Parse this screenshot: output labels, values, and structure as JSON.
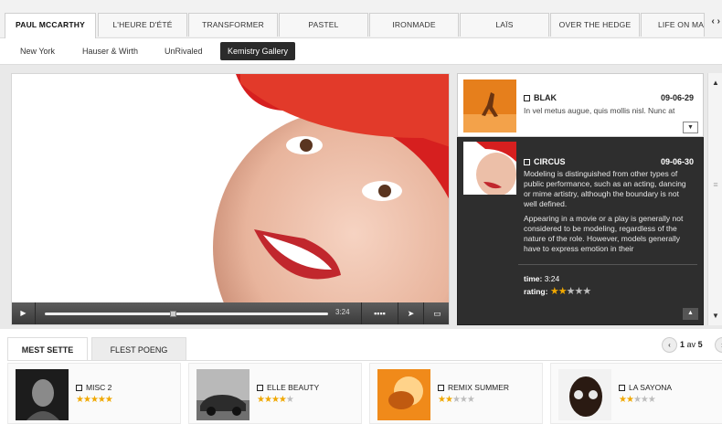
{
  "top_tabs": [
    "PAUL MCCARTHY",
    "L'HEURE D'ÉTÉ",
    "TRANSFORMER",
    "PASTEL",
    "IRONMADE",
    "LAÏS",
    "OVER THE HEDGE",
    "LIFE ON MA"
  ],
  "top_tabs_nav": "‹ ›",
  "sub_tabs": [
    "New York",
    "Hauser & Wirth",
    "UnRivaled",
    "Kemistry Gallery"
  ],
  "video": {
    "time": "3:24"
  },
  "playlist": {
    "items": [
      {
        "title": "BLAK",
        "date": "09-06-29",
        "desc": "In vel metus augue, quis mollis nisl. Nunc at"
      },
      {
        "title": "CIRCUS",
        "date": "09-06-30",
        "desc1": "Modeling is distinguished from other types of public performance, such as an acting, dancing or mime artistry, although the boundary is not well defined.",
        "desc2": "Appearing in a movie or a play is generally not considered to be modeling, regardless of the nature of the role. However, models generally have to express emotion in their",
        "time_label": "time:",
        "time": "3:24",
        "rating_label": "rating:",
        "rating": 2
      }
    ]
  },
  "bottom_tabs": [
    "MEST SETTE",
    "FLEST POENG"
  ],
  "pager": {
    "current": "1",
    "label": "av",
    "total": "5"
  },
  "cards": [
    {
      "title": "MISC 2",
      "rating": 5
    },
    {
      "title": "ELLE BEAUTY",
      "rating": 4
    },
    {
      "title": "REMIX SUMMER",
      "rating": 2
    },
    {
      "title": "LA SAYONA",
      "rating": 2
    }
  ]
}
